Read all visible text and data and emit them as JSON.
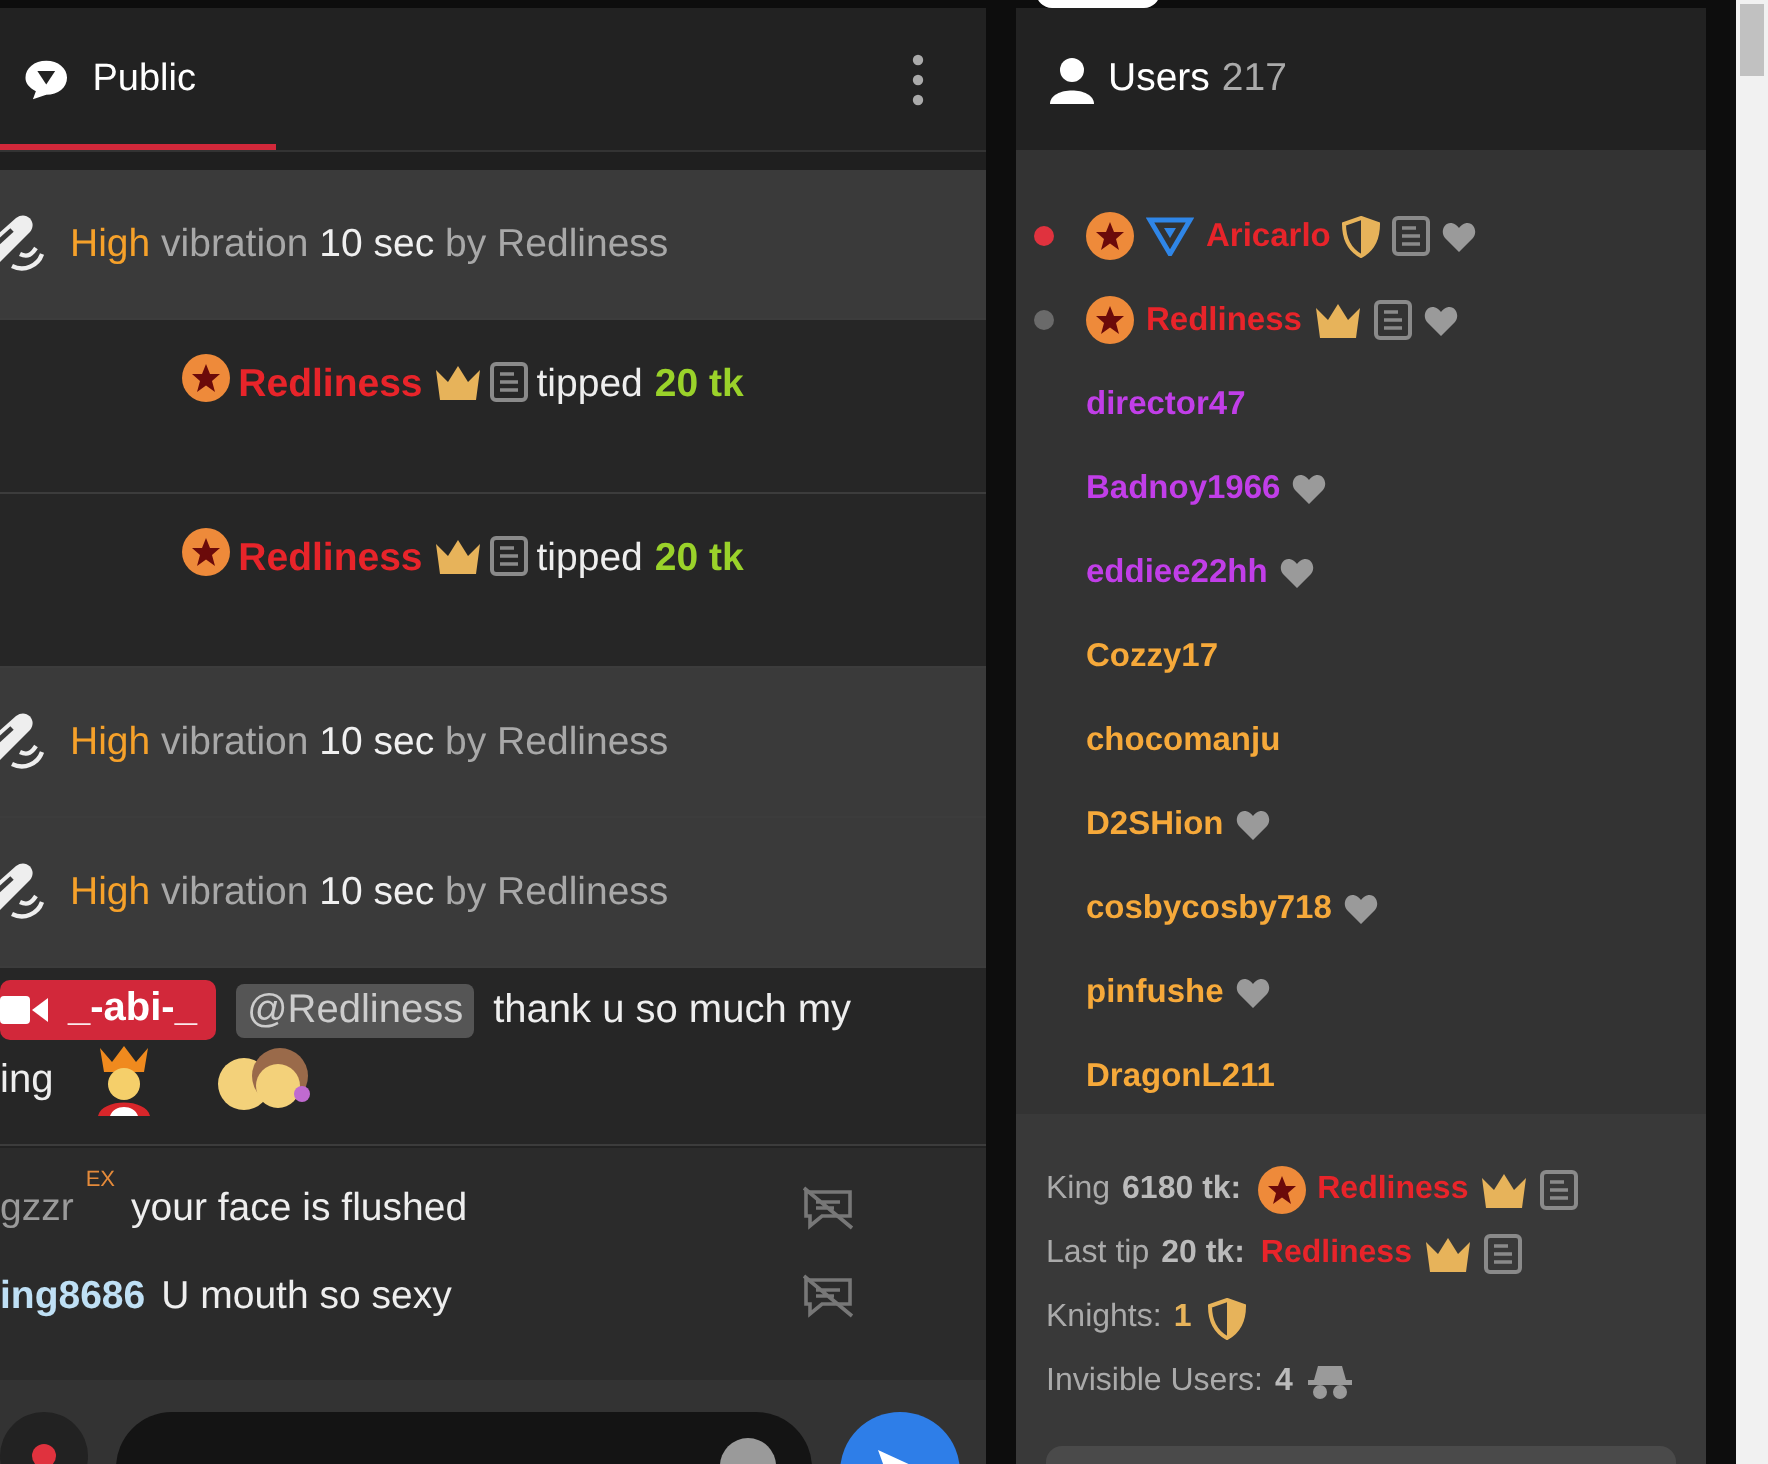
{
  "chat": {
    "tab": {
      "label": "Public",
      "selected": true
    },
    "messages": [
      {
        "kind": "vibration",
        "strength": "High",
        "text": "vibration",
        "duration": "10 sec",
        "by": "by Redliness"
      },
      {
        "kind": "tip",
        "user": "Redliness",
        "action": "tipped",
        "amount": "20 tk"
      },
      {
        "kind": "tip",
        "user": "Redliness",
        "action": "tipped",
        "amount": "20 tk"
      },
      {
        "kind": "vibration",
        "strength": "High",
        "text": "vibration",
        "duration": "10 sec",
        "by": "by Redliness"
      },
      {
        "kind": "vibration",
        "strength": "High",
        "text": "vibration",
        "duration": "10 sec",
        "by": "by Redliness"
      },
      {
        "kind": "mention",
        "badge": "_-abi-_",
        "mention": "@Redliness",
        "text": "thank u so much my",
        "text_2": "ing"
      },
      {
        "kind": "chat",
        "user": "gzzr",
        "color": "#9a9a9a",
        "tag": "EX",
        "text": "your face is flushed"
      },
      {
        "kind": "chat",
        "user": "ing8686",
        "color": "#bfe0f5",
        "text": "U mouth so sexy"
      }
    ]
  },
  "users": {
    "title": "Users",
    "count": "217",
    "items": [
      {
        "name": "Aricarlo",
        "color": "#e8242a",
        "live": true,
        "avatar": true,
        "triangle": true,
        "badges": [
          {
            "kind": "shield"
          },
          {
            "kind": "doc"
          },
          {
            "kind": "heart"
          }
        ]
      },
      {
        "name": "Redliness",
        "color": "#e8242a",
        "live": false,
        "avatar": true,
        "triangle": false,
        "badges": [
          {
            "kind": "crown"
          },
          {
            "kind": "doc"
          },
          {
            "kind": "heart"
          }
        ]
      },
      {
        "name": "director47",
        "color": "#c13ee8",
        "avatar": false,
        "triangle": false
      },
      {
        "name": "Badnoy1966",
        "color": "#c13ee8",
        "avatar": false,
        "triangle": false,
        "badges": [
          {
            "kind": "heart"
          }
        ]
      },
      {
        "name": "eddiee22hh",
        "color": "#c13ee8",
        "avatar": false,
        "triangle": false,
        "badges": [
          {
            "kind": "heart"
          }
        ]
      },
      {
        "name": "Cozzy17",
        "color": "#f6a93a",
        "avatar": false,
        "triangle": false
      },
      {
        "name": "chocomanju",
        "color": "#f6a93a",
        "avatar": false,
        "triangle": false
      },
      {
        "name": "D2SHion",
        "color": "#f6a93a",
        "avatar": false,
        "triangle": false,
        "badges": [
          {
            "kind": "heart"
          }
        ]
      },
      {
        "name": "cosbycosby718",
        "color": "#f6a93a",
        "avatar": false,
        "triangle": false,
        "badges": [
          {
            "kind": "heart"
          }
        ]
      },
      {
        "name": "pinfushe",
        "color": "#f6a93a",
        "avatar": false,
        "triangle": false,
        "badges": [
          {
            "kind": "heart"
          }
        ]
      },
      {
        "name": "DragonL211",
        "color": "#f6a93a",
        "avatar": false,
        "triangle": false
      }
    ]
  },
  "stats": [
    {
      "kind": "king",
      "label": "King",
      "amount": "6180 tk:",
      "user": "Redliness"
    },
    {
      "kind": "last_tip",
      "label": "Last tip",
      "amount": "20 tk:",
      "user": "Redliness"
    },
    {
      "kind": "knights",
      "label": "Knights:",
      "value": "1"
    },
    {
      "kind": "invisible",
      "label": "Invisible Users:",
      "value": "4"
    }
  ]
}
